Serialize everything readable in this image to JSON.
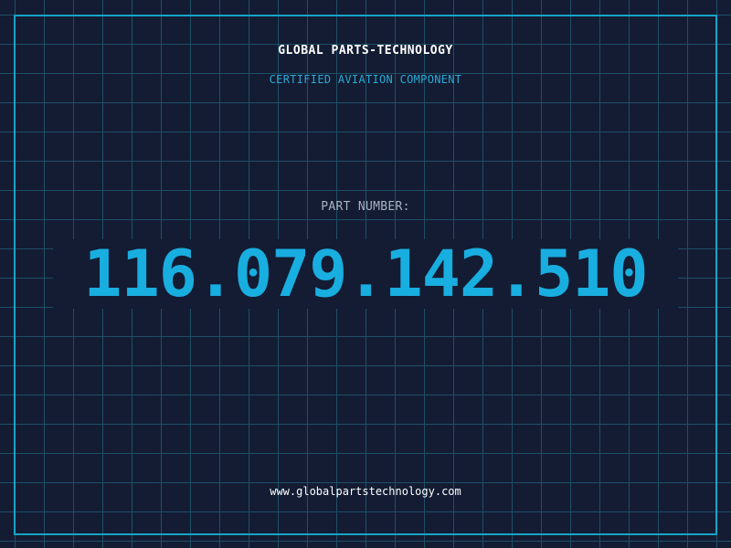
{
  "brand": {
    "title": "GLOBAL PARTS-TECHNOLOGY",
    "subtitle": "CERTIFIED AVIATION COMPONENT"
  },
  "part": {
    "label": "PART NUMBER:",
    "number": "116.079.142.510"
  },
  "footer": {
    "website": "www.globalpartstechnology.com"
  },
  "colors": {
    "background": "#131c33",
    "grid": "#1e4f66",
    "accent": "#19aee0",
    "frame": "#17a3c8",
    "label": "#a9b3c2",
    "text": "#ffffff"
  }
}
